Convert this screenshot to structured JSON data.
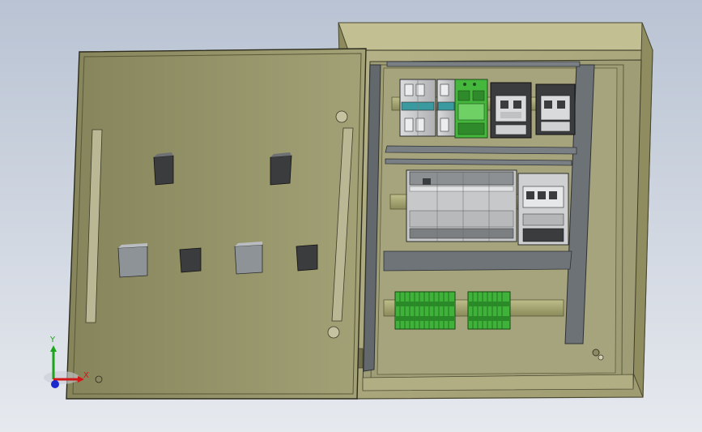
{
  "scene": {
    "description_visible_text": "",
    "colors": {
      "enclosure": "#9c9a6c",
      "enclosure_dark": "#7d7b52",
      "enclosure_light": "#b7b488",
      "interior": "#a9a784",
      "rail": "#6e7378",
      "device_grey": "#c9cbcd",
      "device_dark": "#3a3c3e",
      "terminal_green": "#3fb23a",
      "accent_teal": "#3a9aa0"
    }
  },
  "axis_triad": {
    "x_label": "X",
    "y_label": "Y",
    "x_color": "#d01818",
    "y_color": "#1aa51a",
    "z_color": "#1a2acc"
  }
}
